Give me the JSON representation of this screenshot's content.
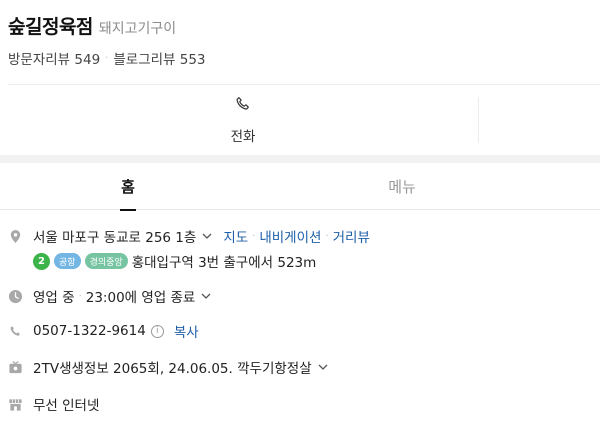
{
  "place": {
    "name": "숲길정육점",
    "category": "돼지고기구이",
    "visitor_reviews": "방문자리뷰 549",
    "blog_reviews": "블로그리뷰 553"
  },
  "actions": {
    "call_label": "전화"
  },
  "tabs": [
    {
      "label": "홈",
      "active": true
    },
    {
      "label": "메뉴",
      "active": false
    }
  ],
  "address": {
    "text": "서울 마포구 동교로 256 1층",
    "links": [
      "지도",
      "내비게이션",
      "거리뷰"
    ]
  },
  "subway": {
    "line_number": "2",
    "badges": [
      "공항",
      "경의중앙"
    ],
    "directions": "홍대입구역 3번 출구에서 523m"
  },
  "hours": {
    "status": "영업 중",
    "detail": "23:00에 영업 종료"
  },
  "phone": {
    "number": "0507-1322-9614",
    "info_icon_label": "i",
    "copy_label": "복사"
  },
  "tv": {
    "text": "2TV생생정보 2065회, 24.06.05. 깍두기항정살"
  },
  "facility": {
    "text": "무선 인터넷"
  },
  "colors": {
    "link": "#1f5fa8",
    "line2": "#3cb44a",
    "airport": "#73b6e4",
    "gyeongui": "#77c4a3"
  }
}
